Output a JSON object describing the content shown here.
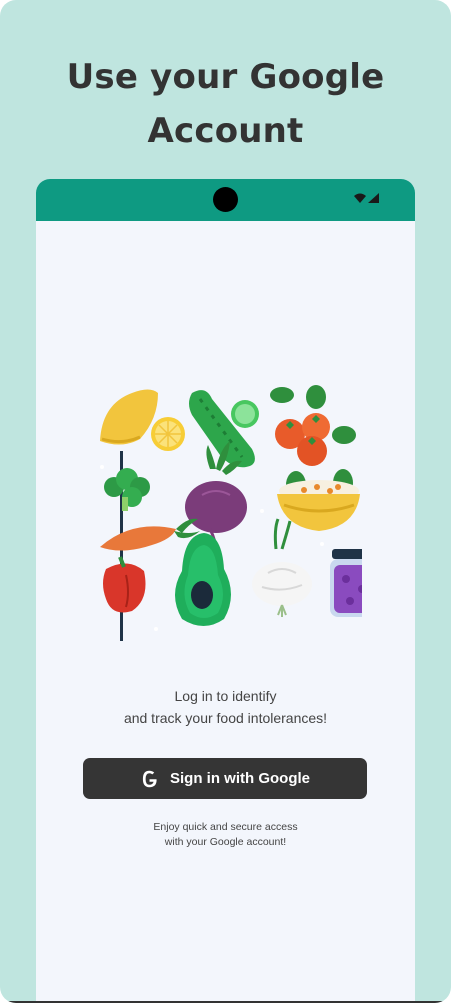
{
  "headline": {
    "line1": "Use your Google",
    "line2": "Account"
  },
  "status_bar": {
    "icons": [
      "wifi-icon",
      "signal-icon"
    ]
  },
  "illustration": {
    "items": [
      "lemon",
      "cucumber",
      "tomatoes",
      "broccoli",
      "beet",
      "bowl",
      "carrot",
      "pepper",
      "avocado",
      "onion",
      "jam-jar"
    ]
  },
  "tagline": {
    "line1": "Log in to identify",
    "line2": "and track your food intolerances!"
  },
  "google_button": {
    "label": "Sign in with Google",
    "icon": "google-g-icon"
  },
  "footnote": {
    "line1": "Enjoy quick and secure access",
    "line2": "with your Google account!"
  },
  "colors": {
    "background": "#bfe5df",
    "status_bar": "#0e9a82",
    "screen": "#f3f6fc",
    "button": "#353535"
  }
}
